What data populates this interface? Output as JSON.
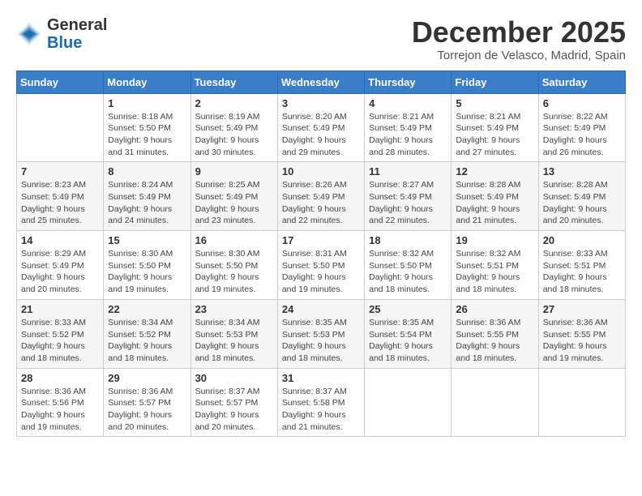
{
  "header": {
    "logo": {
      "general": "General",
      "blue": "Blue"
    },
    "title": "December 2025",
    "location": "Torrejon de Velasco, Madrid, Spain"
  },
  "calendar": {
    "days_of_week": [
      "Sunday",
      "Monday",
      "Tuesday",
      "Wednesday",
      "Thursday",
      "Friday",
      "Saturday"
    ],
    "weeks": [
      [
        {
          "day": "",
          "info": ""
        },
        {
          "day": "1",
          "info": "Sunrise: 8:18 AM\nSunset: 5:50 PM\nDaylight: 9 hours\nand 31 minutes."
        },
        {
          "day": "2",
          "info": "Sunrise: 8:19 AM\nSunset: 5:49 PM\nDaylight: 9 hours\nand 30 minutes."
        },
        {
          "day": "3",
          "info": "Sunrise: 8:20 AM\nSunset: 5:49 PM\nDaylight: 9 hours\nand 29 minutes."
        },
        {
          "day": "4",
          "info": "Sunrise: 8:21 AM\nSunset: 5:49 PM\nDaylight: 9 hours\nand 28 minutes."
        },
        {
          "day": "5",
          "info": "Sunrise: 8:21 AM\nSunset: 5:49 PM\nDaylight: 9 hours\nand 27 minutes."
        },
        {
          "day": "6",
          "info": "Sunrise: 8:22 AM\nSunset: 5:49 PM\nDaylight: 9 hours\nand 26 minutes."
        }
      ],
      [
        {
          "day": "7",
          "info": "Sunrise: 8:23 AM\nSunset: 5:49 PM\nDaylight: 9 hours\nand 25 minutes."
        },
        {
          "day": "8",
          "info": "Sunrise: 8:24 AM\nSunset: 5:49 PM\nDaylight: 9 hours\nand 24 minutes."
        },
        {
          "day": "9",
          "info": "Sunrise: 8:25 AM\nSunset: 5:49 PM\nDaylight: 9 hours\nand 23 minutes."
        },
        {
          "day": "10",
          "info": "Sunrise: 8:26 AM\nSunset: 5:49 PM\nDaylight: 9 hours\nand 22 minutes."
        },
        {
          "day": "11",
          "info": "Sunrise: 8:27 AM\nSunset: 5:49 PM\nDaylight: 9 hours\nand 22 minutes."
        },
        {
          "day": "12",
          "info": "Sunrise: 8:28 AM\nSunset: 5:49 PM\nDaylight: 9 hours\nand 21 minutes."
        },
        {
          "day": "13",
          "info": "Sunrise: 8:28 AM\nSunset: 5:49 PM\nDaylight: 9 hours\nand 20 minutes."
        }
      ],
      [
        {
          "day": "14",
          "info": "Sunrise: 8:29 AM\nSunset: 5:49 PM\nDaylight: 9 hours\nand 20 minutes."
        },
        {
          "day": "15",
          "info": "Sunrise: 8:30 AM\nSunset: 5:50 PM\nDaylight: 9 hours\nand 19 minutes."
        },
        {
          "day": "16",
          "info": "Sunrise: 8:30 AM\nSunset: 5:50 PM\nDaylight: 9 hours\nand 19 minutes."
        },
        {
          "day": "17",
          "info": "Sunrise: 8:31 AM\nSunset: 5:50 PM\nDaylight: 9 hours\nand 19 minutes."
        },
        {
          "day": "18",
          "info": "Sunrise: 8:32 AM\nSunset: 5:50 PM\nDaylight: 9 hours\nand 18 minutes."
        },
        {
          "day": "19",
          "info": "Sunrise: 8:32 AM\nSunset: 5:51 PM\nDaylight: 9 hours\nand 18 minutes."
        },
        {
          "day": "20",
          "info": "Sunrise: 8:33 AM\nSunset: 5:51 PM\nDaylight: 9 hours\nand 18 minutes."
        }
      ],
      [
        {
          "day": "21",
          "info": "Sunrise: 8:33 AM\nSunset: 5:52 PM\nDaylight: 9 hours\nand 18 minutes."
        },
        {
          "day": "22",
          "info": "Sunrise: 8:34 AM\nSunset: 5:52 PM\nDaylight: 9 hours\nand 18 minutes."
        },
        {
          "day": "23",
          "info": "Sunrise: 8:34 AM\nSunset: 5:53 PM\nDaylight: 9 hours\nand 18 minutes."
        },
        {
          "day": "24",
          "info": "Sunrise: 8:35 AM\nSunset: 5:53 PM\nDaylight: 9 hours\nand 18 minutes."
        },
        {
          "day": "25",
          "info": "Sunrise: 8:35 AM\nSunset: 5:54 PM\nDaylight: 9 hours\nand 18 minutes."
        },
        {
          "day": "26",
          "info": "Sunrise: 8:36 AM\nSunset: 5:55 PM\nDaylight: 9 hours\nand 18 minutes."
        },
        {
          "day": "27",
          "info": "Sunrise: 8:36 AM\nSunset: 5:55 PM\nDaylight: 9 hours\nand 19 minutes."
        }
      ],
      [
        {
          "day": "28",
          "info": "Sunrise: 8:36 AM\nSunset: 5:56 PM\nDaylight: 9 hours\nand 19 minutes."
        },
        {
          "day": "29",
          "info": "Sunrise: 8:36 AM\nSunset: 5:57 PM\nDaylight: 9 hours\nand 20 minutes."
        },
        {
          "day": "30",
          "info": "Sunrise: 8:37 AM\nSunset: 5:57 PM\nDaylight: 9 hours\nand 20 minutes."
        },
        {
          "day": "31",
          "info": "Sunrise: 8:37 AM\nSunset: 5:58 PM\nDaylight: 9 hours\nand 21 minutes."
        },
        {
          "day": "",
          "info": ""
        },
        {
          "day": "",
          "info": ""
        },
        {
          "day": "",
          "info": ""
        }
      ]
    ]
  }
}
